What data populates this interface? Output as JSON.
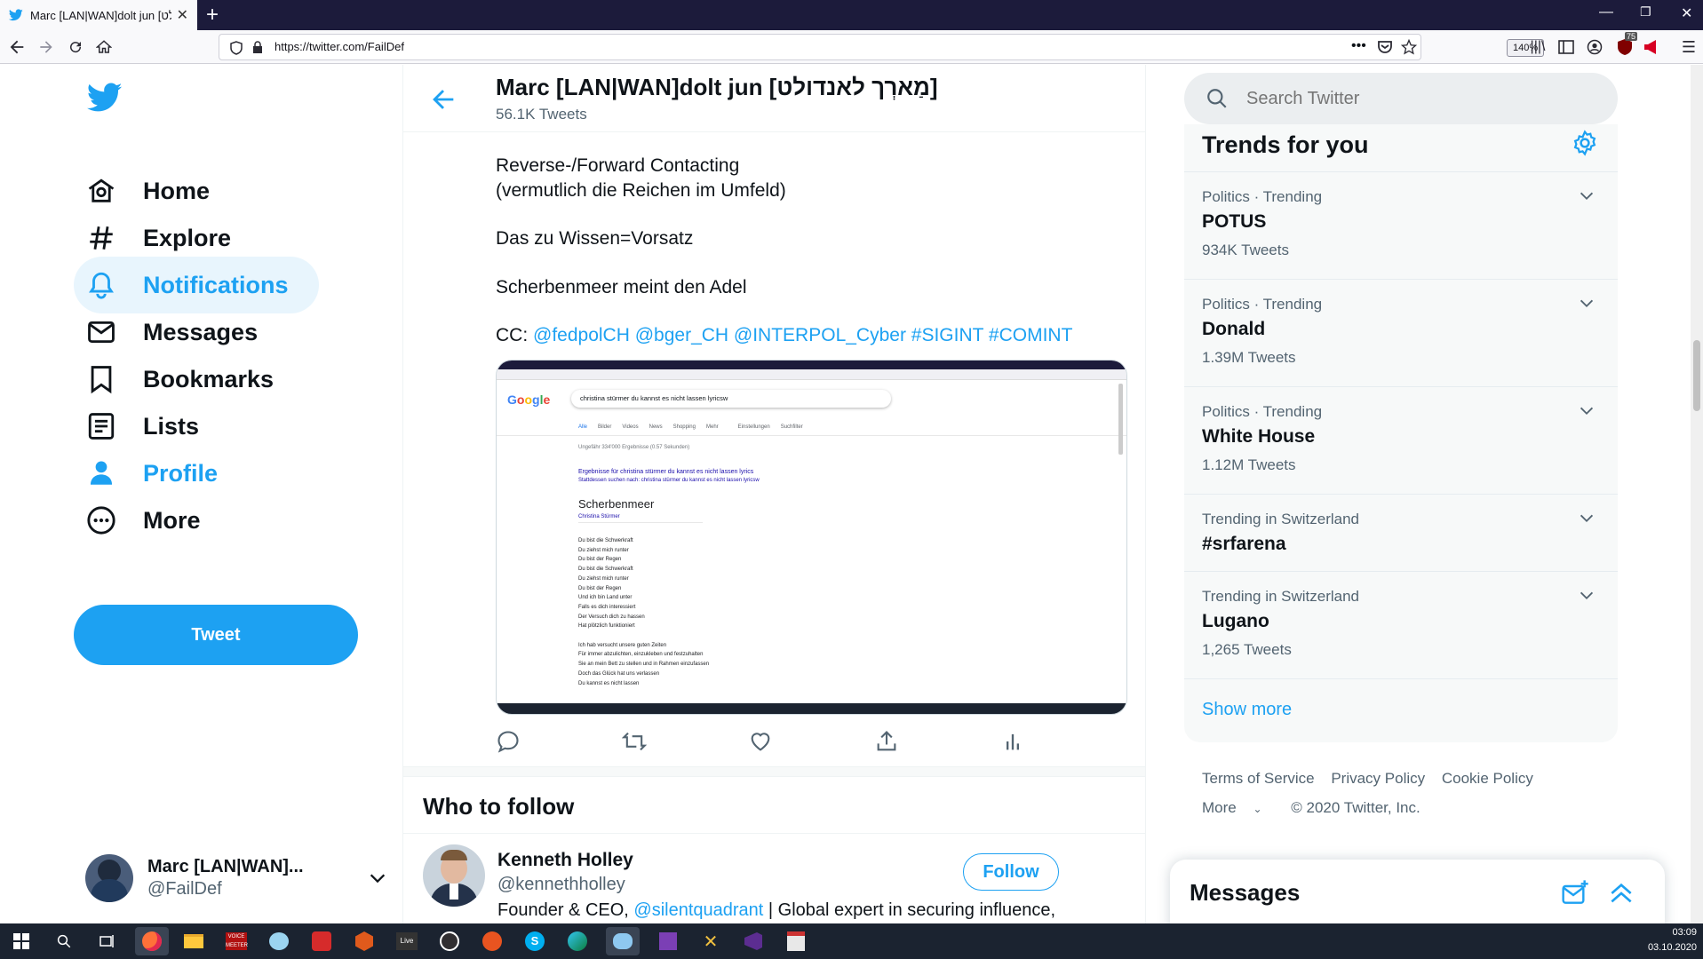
{
  "browser": {
    "tab_title": "Marc [LAN|WAN]dolt jun [מַארְך לאנדולט]",
    "url": "https://twitter.com/FailDef",
    "zoom": "140%",
    "new_tab": "+",
    "badge_count": "75"
  },
  "nav": {
    "items": [
      {
        "label": "Home",
        "icon": "home-icon"
      },
      {
        "label": "Explore",
        "icon": "hashtag-icon"
      },
      {
        "label": "Notifications",
        "icon": "bell-icon",
        "active": true
      },
      {
        "label": "Messages",
        "icon": "envelope-icon"
      },
      {
        "label": "Bookmarks",
        "icon": "bookmark-icon"
      },
      {
        "label": "Lists",
        "icon": "list-icon"
      },
      {
        "label": "Profile",
        "icon": "person-icon"
      },
      {
        "label": "More",
        "icon": "more-icon"
      }
    ],
    "tweet_button": "Tweet",
    "account_name": "Marc [LAN|WAN]...",
    "account_handle": "@FailDef"
  },
  "header": {
    "name": "Marc [LAN|WAN]dolt jun [מַארְך לאנדולט]",
    "tweet_count": "56.1K Tweets"
  },
  "tweet": {
    "line1": "Reverse-/Forward Contacting",
    "line2": "(vermutlich die Reichen im Umfeld)",
    "line3": "Das zu Wissen=Vorsatz",
    "line4": "Scherbenmeer meint den Adel",
    "cc_label": "CC:",
    "cc_mentions": "@fedpolCH @bger_CH @INTERPOL_Cyber #SIGINT #COMINT",
    "embedded": {
      "search_query": "christina stürmer du kannst es nicht lassen lyricsw",
      "result_count": "Ungefähr 334'000 Ergebnisse (0.57 Sekunden)",
      "correction": "Ergebnisse für christina stürmer du kannst es nicht lassen lyrics",
      "instead": "Stattdessen suchen nach: christina stürmer du kannst es nicht lassen lyricsw",
      "song_title": "Scherbenmeer",
      "artist": "Christina Stürmer",
      "tabs": [
        "Alle",
        "Bilder",
        "Videos",
        "News",
        "Shopping",
        "Mehr",
        "Einstellungen",
        "Suchfilter"
      ],
      "lyrics": [
        "Du bist die Schwerkraft",
        "Du ziehst mich runter",
        "Du bist der Regen",
        "Du bist die Schwerkraft",
        "Du ziehst mich runter",
        "Du bist der Regen",
        "Und ich bin Land unter",
        "Falls es dich interessiert",
        "Der Versuch dich zu hassen",
        "Hat plötzlich funktioniert",
        "",
        "Ich hab versucht unsere guten Zeiten",
        "Für immer abzulichten, einzukleben und festzuhalten",
        "Sie an mein Bett zu stellen und in Rahmen einzufassen",
        "Doch das Glück hat uns verlassen",
        "Du kannst es nicht lassen"
      ]
    }
  },
  "who_to_follow": {
    "title": "Who to follow",
    "name": "Kenneth Holley",
    "handle": "@kennethholley",
    "bio_start": "Founder & CEO,",
    "bio_mention": "@silentquadrant",
    "bio_end": "| Global expert in securing influence,",
    "follow_label": "Follow"
  },
  "search": {
    "placeholder": "Search Twitter"
  },
  "trends": {
    "title": "Trends for you",
    "items": [
      {
        "meta": "Politics · Trending",
        "name": "POTUS",
        "count": "934K Tweets"
      },
      {
        "meta": "Politics · Trending",
        "name": "Donald",
        "count": "1.39M Tweets"
      },
      {
        "meta": "Politics · Trending",
        "name": "White House",
        "count": "1.12M Tweets"
      },
      {
        "meta": "Trending in Switzerland",
        "name": "#srfarena",
        "count": ""
      },
      {
        "meta": "Trending in Switzerland",
        "name": "Lugano",
        "count": "1,265 Tweets"
      }
    ],
    "show_more": "Show more"
  },
  "footer": {
    "terms": "Terms of Service",
    "privacy": "Privacy Policy",
    "cookie": "Cookie Policy",
    "more": "More",
    "copyright": "© 2020 Twitter, Inc."
  },
  "messages_dock": {
    "title": "Messages"
  },
  "taskbar": {
    "time": "03:09",
    "date": "03.10.2020"
  },
  "colors": {
    "accent": "#1da1f2",
    "text": "#0f1419",
    "muted": "#536471"
  }
}
